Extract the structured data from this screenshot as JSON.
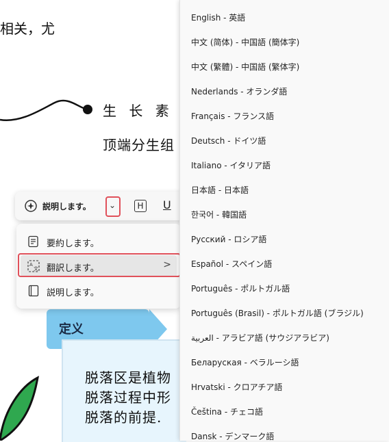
{
  "document": {
    "top_text": "相关，尤",
    "note_line_1": "生 长 素 在",
    "note_line_2": "顶端分生组",
    "definition_label": "定义",
    "definition_lines": [
      "脱落区是植物",
      "脱落过程中形",
      "脱落的前提."
    ]
  },
  "toolbar": {
    "ai_label": "説明します。",
    "dropdown_glyph": "⌄",
    "heading_glyph": "H",
    "underline_glyph": "U"
  },
  "menu": {
    "items": [
      {
        "label": "要約します。",
        "icon": "summary-icon"
      },
      {
        "label": "翻訳します。",
        "icon": "translate-icon",
        "selected": true
      },
      {
        "label": "説明します。",
        "icon": "book-icon"
      }
    ],
    "chevron": ">"
  },
  "languages": [
    "English - 英語",
    "中文 (简体) - 中国語 (簡体字)",
    "中文 (繁體) - 中国語 (繁体字)",
    "Nederlands - オランダ語",
    "Français - フランス語",
    "Deutsch - ドイツ語",
    "Italiano - イタリア語",
    "日本語 - 日本語",
    "한국어 - 韓国語",
    "Русский - ロシア語",
    "Español - スペイン語",
    "Português - ポルトガル語",
    "Português (Brasil) - ポルトガル語 (ブラジル)",
    "العربية - アラビア語 (サウジアラビア)",
    "Беларуская - ベラルーシ語",
    "Hrvatski - クロアチア語",
    "Čeština - チェコ語",
    "Dansk - デンマーク語"
  ],
  "colors": {
    "highlight_red": "#e0505a",
    "definition_tag": "#7ec8ee",
    "definition_box": "#e7f5fd"
  }
}
